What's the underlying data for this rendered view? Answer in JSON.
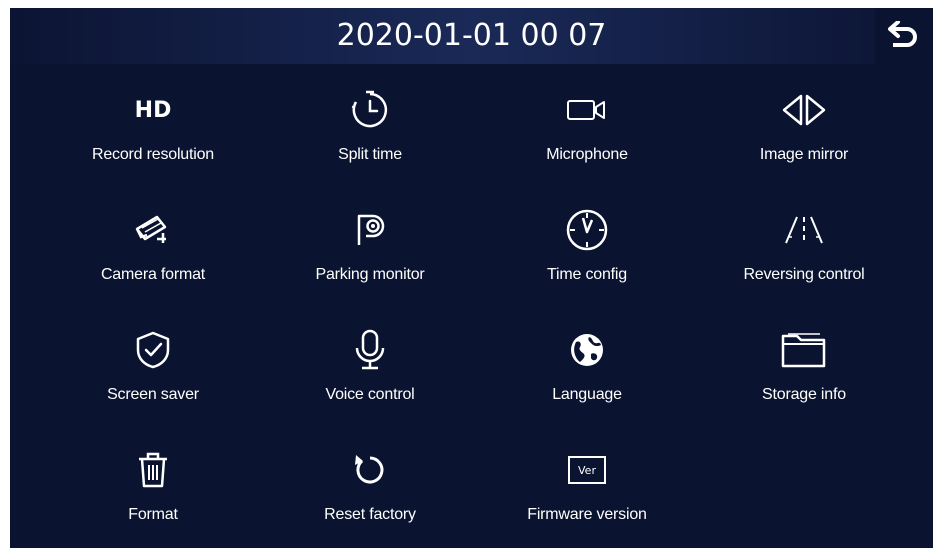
{
  "header": {
    "datetime": "2020-01-01  00 07"
  },
  "colors": {
    "background": "#0a1330",
    "header_accent": "#1a2957",
    "icon": "#ffffff"
  },
  "menu": [
    {
      "label": "Record resolution",
      "icon": "hd-icon",
      "icon_text": "HD"
    },
    {
      "label": "Split time",
      "icon": "timer-icon"
    },
    {
      "label": "Microphone",
      "icon": "video-camera-icon"
    },
    {
      "label": "Image mirror",
      "icon": "mirror-icon"
    },
    {
      "label": "Camera format",
      "icon": "cctv-camera-icon"
    },
    {
      "label": "Parking monitor",
      "icon": "parking-icon"
    },
    {
      "label": "Time config",
      "icon": "clock-icon"
    },
    {
      "label": "Reversing control",
      "icon": "reversing-lines-icon"
    },
    {
      "label": "Screen saver",
      "icon": "shield-check-icon"
    },
    {
      "label": "Voice control",
      "icon": "microphone-icon"
    },
    {
      "label": "Language",
      "icon": "globe-icon"
    },
    {
      "label": "Storage info",
      "icon": "folder-icon"
    },
    {
      "label": "Format",
      "icon": "trash-icon"
    },
    {
      "label": "Reset factory",
      "icon": "reset-icon"
    },
    {
      "label": "Firmware version",
      "icon": "ver-icon",
      "icon_text": "Ver"
    }
  ]
}
